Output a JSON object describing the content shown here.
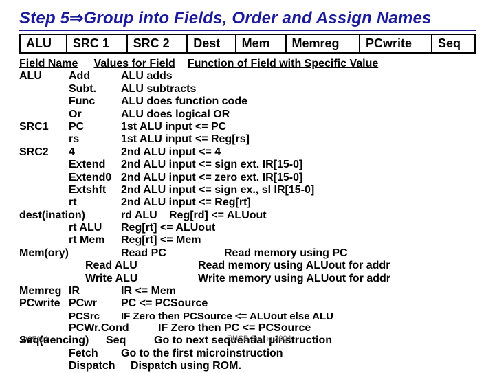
{
  "title_pre": "Step 5",
  "title_arrow": "⇒",
  "title_post": "Group into Fields, Order and Assign Names",
  "hcells": [
    "ALU",
    "SRC 1",
    "SRC 2",
    "Dest",
    "Mem",
    "Memreg",
    "PCwrite",
    "Seq"
  ],
  "col_hdrs": {
    "c1": "Field Name",
    "c2": "Values for Field",
    "c3": "Function of Field with Specific Value"
  },
  "rows": [
    {
      "c1": "ALU",
      "c2": "Add",
      "c3": "ALU adds"
    },
    {
      "c1": "",
      "c2": "Subt.",
      "c3": "ALU subtracts"
    },
    {
      "c1": "",
      "c2": "Func",
      "c3": "ALU does function code"
    },
    {
      "c1": "",
      "c2": "Or",
      "c3": "ALU does logical OR"
    },
    {
      "c1": "SRC1",
      "c2": "PC",
      "c3": "1st ALU input <= PC"
    },
    {
      "c1": "",
      "c2": "rs",
      "c3": "1st ALU input <= Reg[rs]"
    },
    {
      "c1": "SRC2",
      "c2": "4",
      "c3": "2nd ALU input <= 4"
    },
    {
      "c1": "",
      "c2": "Extend",
      "c3": "2nd ALU input <= sign ext. IR[15-0]"
    },
    {
      "c1": "",
      "c2": "Extend0",
      "c3": "2nd ALU input <= zero ext. IR[15-0]"
    },
    {
      "c1": "",
      "c2": "Extshft",
      "c3": "2nd ALU input <= sign ex., sl IR[15-0]"
    },
    {
      "c1": "",
      "c2": "rt",
      "c3": "2nd ALU input <= Reg[rt]"
    }
  ],
  "dest_label": "dest(ination)",
  "dest_rows": [
    {
      "c2": "rd ALU",
      "c3": "Reg[rd] <= ALUout"
    },
    {
      "c2": "rt ALU",
      "c3": "Reg[rt] <= ALUout"
    },
    {
      "c2": "rt Mem",
      "c3": "Reg[rt] <= Mem"
    }
  ],
  "mem_label": "Mem(ory)",
  "mem_rows": [
    {
      "c2": "Read PC",
      "c3": "Read memory using PC"
    },
    {
      "c2": "Read ALU",
      "c3": "Read memory using ALUout for addr"
    },
    {
      "c2": "Write ALU",
      "c3": "Write memory using ALUout for addr"
    }
  ],
  "memreg": {
    "c1": "Memreg",
    "c2": "IR",
    "c3": "IR <= Mem"
  },
  "pcwrite_label": "PCwrite",
  "pcwrite_rows": [
    {
      "c2": "PCwr",
      "c3": "PC <= PCSource"
    },
    {
      "c2": "PCSrc",
      "c3": "IF Zero then PCSource <= ALUout else  ALU"
    },
    {
      "c2": "PCWr.Cond",
      "c3": "IF Zero then PC <= PCSource"
    }
  ],
  "seq_label": "Seq(uencing)",
  "seq_rows": [
    {
      "c2": "Seq",
      "c3": "Go to next sequential µinstruction"
    },
    {
      "c2": "Fetch",
      "c3": "Go to the first microinstruction"
    },
    {
      "c2": "Dispatch",
      "c3": "Dispatch using ROM."
    }
  ],
  "date": "2/25/04",
  "copyright": "©UCB Spring 2004"
}
